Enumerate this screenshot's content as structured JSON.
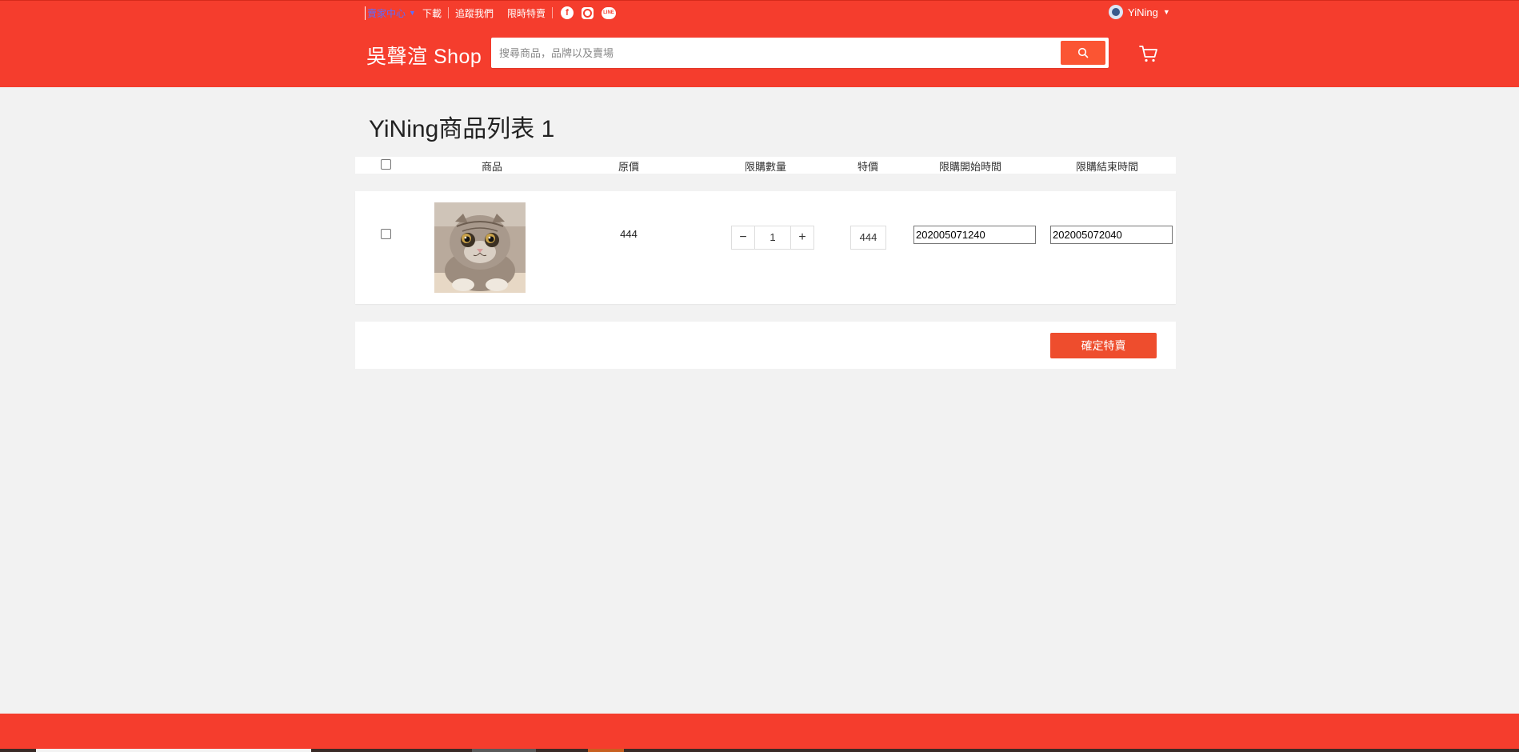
{
  "header": {
    "top_nav": {
      "seller_center": "賣家中心",
      "download": "下載",
      "follow_us": "追蹤我們",
      "flash_sale": "限時特賣"
    },
    "social_icons": [
      "facebook-icon",
      "instagram-icon",
      "line-icon"
    ],
    "user": {
      "name": "YiNing"
    },
    "brand": "吳聲渲 Shop",
    "search": {
      "placeholder": "搜尋商品，品牌以及賣場",
      "value": ""
    }
  },
  "main": {
    "title": "YiNing商品列表 1",
    "columns": [
      "商品",
      "原價",
      "限購數量",
      "特價",
      "限購開始時間",
      "限購結束時間"
    ],
    "rows": [
      {
        "checked": false,
        "product_image": "cat-photo",
        "original_price": "444",
        "quantity": "1",
        "special_price": "444",
        "start_time": "202005071240",
        "end_time": "202005072040"
      }
    ],
    "confirm_label": "確定特賣"
  },
  "colors": {
    "header_bg": "#f53d2d",
    "button_bg": "#ee4d2d",
    "page_bg": "#f2f2f2"
  }
}
